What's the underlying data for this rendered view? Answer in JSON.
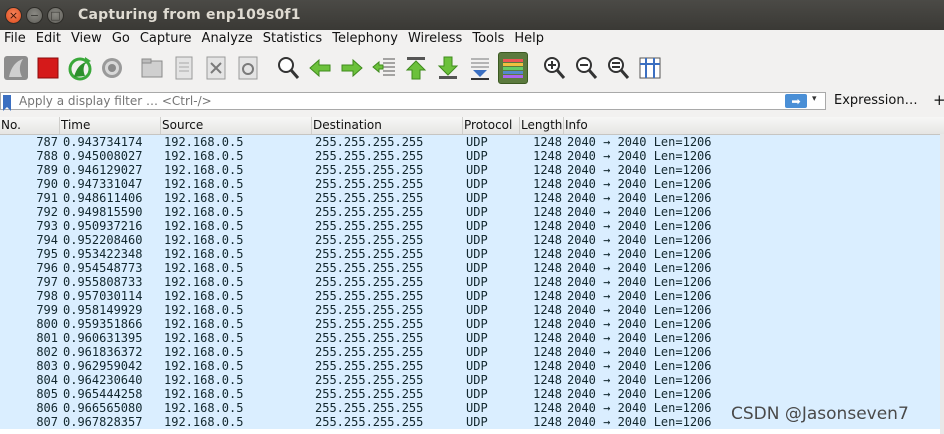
{
  "window": {
    "title": "Capturing from enp109s0f1",
    "close_glyph": "×",
    "minimize_glyph": "−",
    "maximize_glyph": "□"
  },
  "menu": [
    "File",
    "Edit",
    "View",
    "Go",
    "Capture",
    "Analyze",
    "Statistics",
    "Telephony",
    "Wireless",
    "Tools",
    "Help"
  ],
  "toolbar_icons": [
    "start-capture-fin-icon",
    "stop-capture-icon",
    "restart-capture-icon",
    "capture-options-gear-icon",
    "open-file-icon",
    "save-file-icon",
    "close-file-icon",
    "reload-file-icon",
    "find-packet-icon",
    "go-back-icon",
    "go-forward-icon",
    "go-to-packet-icon",
    "go-first-icon",
    "go-last-icon",
    "autoscroll-icon",
    "colorize-icon",
    "zoom-in-icon",
    "zoom-out-icon",
    "zoom-normal-icon",
    "resize-columns-icon"
  ],
  "filter": {
    "placeholder": "Apply a display filter … <Ctrl-/>",
    "apply_glyph": "➡",
    "dropdown_glyph": "▾",
    "expression_label": "Expression…",
    "add_label": "+"
  },
  "columns": [
    "No.",
    "Time",
    "Source",
    "Destination",
    "Protocol",
    "Length",
    "Info"
  ],
  "packets": [
    {
      "no": "787",
      "time": "0.943734174",
      "src": "192.168.0.5",
      "dst": "255.255.255.255",
      "proto": "UDP",
      "len": "1248",
      "info": "2040 → 2040 Len=1206"
    },
    {
      "no": "788",
      "time": "0.945008027",
      "src": "192.168.0.5",
      "dst": "255.255.255.255",
      "proto": "UDP",
      "len": "1248",
      "info": "2040 → 2040 Len=1206"
    },
    {
      "no": "789",
      "time": "0.946129027",
      "src": "192.168.0.5",
      "dst": "255.255.255.255",
      "proto": "UDP",
      "len": "1248",
      "info": "2040 → 2040 Len=1206"
    },
    {
      "no": "790",
      "time": "0.947331047",
      "src": "192.168.0.5",
      "dst": "255.255.255.255",
      "proto": "UDP",
      "len": "1248",
      "info": "2040 → 2040 Len=1206"
    },
    {
      "no": "791",
      "time": "0.948611406",
      "src": "192.168.0.5",
      "dst": "255.255.255.255",
      "proto": "UDP",
      "len": "1248",
      "info": "2040 → 2040 Len=1206"
    },
    {
      "no": "792",
      "time": "0.949815590",
      "src": "192.168.0.5",
      "dst": "255.255.255.255",
      "proto": "UDP",
      "len": "1248",
      "info": "2040 → 2040 Len=1206"
    },
    {
      "no": "793",
      "time": "0.950937216",
      "src": "192.168.0.5",
      "dst": "255.255.255.255",
      "proto": "UDP",
      "len": "1248",
      "info": "2040 → 2040 Len=1206"
    },
    {
      "no": "794",
      "time": "0.952208460",
      "src": "192.168.0.5",
      "dst": "255.255.255.255",
      "proto": "UDP",
      "len": "1248",
      "info": "2040 → 2040 Len=1206"
    },
    {
      "no": "795",
      "time": "0.953422348",
      "src": "192.168.0.5",
      "dst": "255.255.255.255",
      "proto": "UDP",
      "len": "1248",
      "info": "2040 → 2040 Len=1206"
    },
    {
      "no": "796",
      "time": "0.954548773",
      "src": "192.168.0.5",
      "dst": "255.255.255.255",
      "proto": "UDP",
      "len": "1248",
      "info": "2040 → 2040 Len=1206"
    },
    {
      "no": "797",
      "time": "0.955808733",
      "src": "192.168.0.5",
      "dst": "255.255.255.255",
      "proto": "UDP",
      "len": "1248",
      "info": "2040 → 2040 Len=1206"
    },
    {
      "no": "798",
      "time": "0.957030114",
      "src": "192.168.0.5",
      "dst": "255.255.255.255",
      "proto": "UDP",
      "len": "1248",
      "info": "2040 → 2040 Len=1206"
    },
    {
      "no": "799",
      "time": "0.958149929",
      "src": "192.168.0.5",
      "dst": "255.255.255.255",
      "proto": "UDP",
      "len": "1248",
      "info": "2040 → 2040 Len=1206"
    },
    {
      "no": "800",
      "time": "0.959351866",
      "src": "192.168.0.5",
      "dst": "255.255.255.255",
      "proto": "UDP",
      "len": "1248",
      "info": "2040 → 2040 Len=1206"
    },
    {
      "no": "801",
      "time": "0.960631395",
      "src": "192.168.0.5",
      "dst": "255.255.255.255",
      "proto": "UDP",
      "len": "1248",
      "info": "2040 → 2040 Len=1206"
    },
    {
      "no": "802",
      "time": "0.961836372",
      "src": "192.168.0.5",
      "dst": "255.255.255.255",
      "proto": "UDP",
      "len": "1248",
      "info": "2040 → 2040 Len=1206"
    },
    {
      "no": "803",
      "time": "0.962959042",
      "src": "192.168.0.5",
      "dst": "255.255.255.255",
      "proto": "UDP",
      "len": "1248",
      "info": "2040 → 2040 Len=1206"
    },
    {
      "no": "804",
      "time": "0.964230640",
      "src": "192.168.0.5",
      "dst": "255.255.255.255",
      "proto": "UDP",
      "len": "1248",
      "info": "2040 → 2040 Len=1206"
    },
    {
      "no": "805",
      "time": "0.965444258",
      "src": "192.168.0.5",
      "dst": "255.255.255.255",
      "proto": "UDP",
      "len": "1248",
      "info": "2040 → 2040 Len=1206"
    },
    {
      "no": "806",
      "time": "0.966565080",
      "src": "192.168.0.5",
      "dst": "255.255.255.255",
      "proto": "UDP",
      "len": "1248",
      "info": "2040 → 2040 Len=1206"
    },
    {
      "no": "807",
      "time": "0.967828357",
      "src": "192.168.0.5",
      "dst": "255.255.255.255",
      "proto": "UDP",
      "len": "1248",
      "info": "2040 → 2040 Len=1206"
    }
  ],
  "colors": {
    "row_udp": "#daeeff",
    "row_text": "#12272e",
    "title_bg": "#3c3b37"
  },
  "watermark": "CSDN @Jasonseven7"
}
